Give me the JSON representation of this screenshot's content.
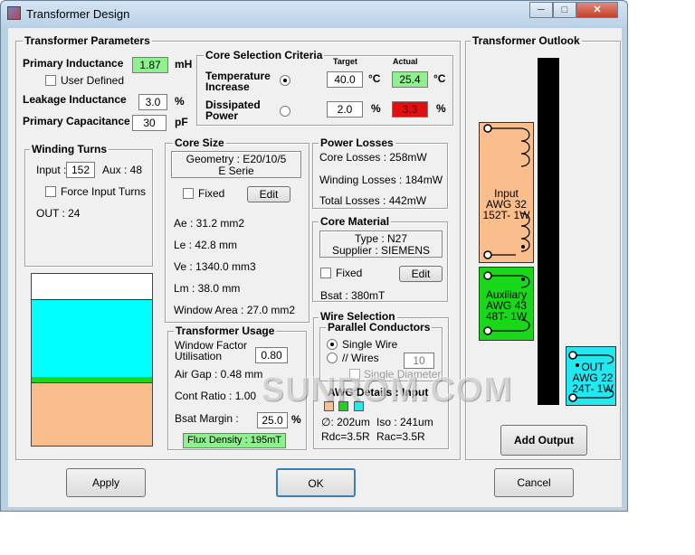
{
  "window": {
    "title": "Transformer Design",
    "minimize": "─",
    "maximize": "□",
    "close": "✕"
  },
  "params": {
    "group": "Transformer Parameters",
    "primary_inductance_label": "Primary Inductance",
    "primary_inductance_value": "1.87",
    "primary_inductance_unit": "mH",
    "user_defined_label": "User Defined",
    "leakage_label": "Leakage Inductance",
    "leakage_value": "3.0",
    "leakage_unit": "%",
    "capacitance_label": "Primary Capacitance",
    "capacitance_value": "30",
    "capacitance_unit": "pF"
  },
  "criteria": {
    "group": "Core Selection Criteria",
    "target_header": "Target",
    "actual_header": "Actual",
    "temp_label": "Temperature Increase",
    "temp_target": "40.0",
    "temp_unit": "°C",
    "temp_actual": "25.4",
    "temp_actual_unit": "°C",
    "power_label": "Dissipated Power",
    "power_target": "2.0",
    "power_unit": "%",
    "power_actual": "3.3",
    "power_actual_unit": "%"
  },
  "winding": {
    "group": "Winding Turns",
    "input_label": "Input :",
    "input_value": "152",
    "aux": "Aux : 48",
    "force_label": "Force Input Turns",
    "out": "OUT : 24"
  },
  "core_size": {
    "group": "Core Size",
    "geometry": "Geometry : E20/10/5",
    "serie": "E Serie",
    "fixed_label": "Fixed",
    "edit": "Edit",
    "ae": "Ae : 31.2 mm2",
    "le": "Le : 42.8 mm",
    "ve": "Ve : 1340.0 mm3",
    "lm": "Lm : 38.0 mm",
    "window_area": "Window Area : 27.0 mm2"
  },
  "power_losses": {
    "group": "Power Losses",
    "core": "Core Losses : 258mW",
    "winding": "Winding Losses : 184mW",
    "total": "Total Losses : 442mW"
  },
  "core_material": {
    "group": "Core Material",
    "type": "Type : N27",
    "supplier": "Supplier : SIEMENS",
    "fixed_label": "Fixed",
    "edit": "Edit",
    "bsat": "Bsat : 380mT"
  },
  "usage": {
    "group": "Transformer Usage",
    "wf_label": "Window Factor Utilisation",
    "wf_value": "0.80",
    "air_gap": "Air Gap : 0.48 mm",
    "cont_ratio": "Cont Ratio : 1.00",
    "bsat_label": "Bsat Margin :",
    "bsat_value": "25.0",
    "bsat_unit": "%",
    "flux": "Flux Density : 195mT"
  },
  "wire": {
    "group": "Wire Selection",
    "parallel": "Parallel Conductors",
    "single": "Single Wire",
    "multi": "// Wires",
    "multi_value": "10",
    "single_diameter": "Single Diameter",
    "awg_details": "AWG Details : Input",
    "diameter": "∅: 202um",
    "iso": "Iso : 241um",
    "rdc": "Rdc=3.5R",
    "rac": "Rac=3.5R",
    "swatch_colors": [
      "#f9be8c",
      "#19d719",
      "#24e8f0"
    ]
  },
  "outlook": {
    "group": "Transformer Outlook",
    "input_coil": [
      "Input",
      "AWG 32",
      "152T- 1W"
    ],
    "aux_coil": [
      "Auxiliary",
      "AWG 43",
      "48T- 1W"
    ],
    "out_coil": [
      "OUT",
      "AWG 22",
      "24T- 1W"
    ],
    "add_output": "Add Output",
    "colors": {
      "input": "#f9be8c",
      "aux": "#19d719",
      "out": "#24e8f0"
    }
  },
  "window_fill": {
    "cyan_fraction": 0.45,
    "green_fraction": 0.03,
    "orange_fraction": 0.37
  },
  "footer": {
    "apply": "Apply",
    "ok": "OK",
    "cancel": "Cancel"
  },
  "watermark": "SUNROM.COM"
}
